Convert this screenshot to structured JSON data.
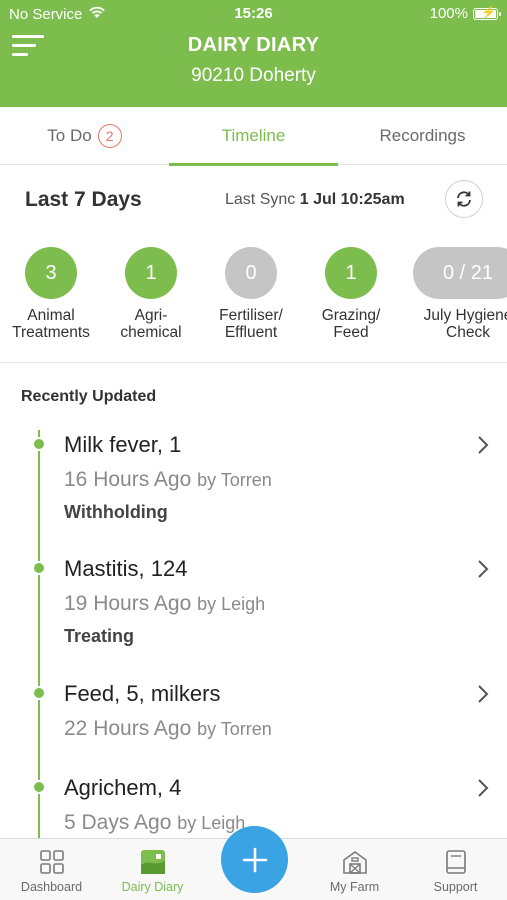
{
  "status_bar": {
    "carrier": "No Service",
    "time": "15:26",
    "battery": "100%"
  },
  "header": {
    "title": "DAIRY DIARY",
    "subtitle": "90210 Doherty"
  },
  "tabs": [
    {
      "label": "To Do",
      "badge": "2"
    },
    {
      "label": "Timeline",
      "active": true
    },
    {
      "label": "Recordings"
    }
  ],
  "period": {
    "title": "Last 7 Days",
    "sync_label": "Last Sync",
    "sync_value": "1 Jul 10:25am"
  },
  "categories": [
    {
      "count": "3",
      "label": "Animal\nTreatments",
      "color": "green"
    },
    {
      "count": "1",
      "label": "Agri-\nchemical",
      "color": "green"
    },
    {
      "count": "0",
      "label": "Fertiliser/\nEffluent",
      "color": "grey"
    },
    {
      "count": "1",
      "label": "Grazing/\nFeed",
      "color": "green"
    },
    {
      "count": "0 / 21",
      "label": "July Hygiene\nCheck",
      "color": "grey"
    }
  ],
  "recent": {
    "heading": "Recently Updated",
    "entries": [
      {
        "title": "Milk fever, 1",
        "time": "16 Hours Ago",
        "by": "by Torren",
        "status": "Withholding"
      },
      {
        "title": "Mastitis, 124",
        "time": "19 Hours Ago",
        "by": "by Leigh",
        "status": "Treating"
      },
      {
        "title": "Feed, 5, milkers",
        "time": "22 Hours Ago",
        "by": "by Torren",
        "status": ""
      },
      {
        "title": "Agrichem, 4",
        "time": "5 Days Ago",
        "by": "by Leigh",
        "status": ""
      }
    ]
  },
  "bottom_nav": [
    {
      "label": "Dashboard",
      "icon": "grid-icon"
    },
    {
      "label": "Dairy Diary",
      "icon": "diary-icon",
      "active": true
    },
    {
      "label": "My Farm",
      "icon": "barn-icon"
    },
    {
      "label": "Support",
      "icon": "book-icon"
    }
  ],
  "colors": {
    "brand_green": "#7cbd4e",
    "fab_blue": "#3aa3e3",
    "badge_red": "#e8766a",
    "inactive_grey": "#c5c5c5"
  }
}
